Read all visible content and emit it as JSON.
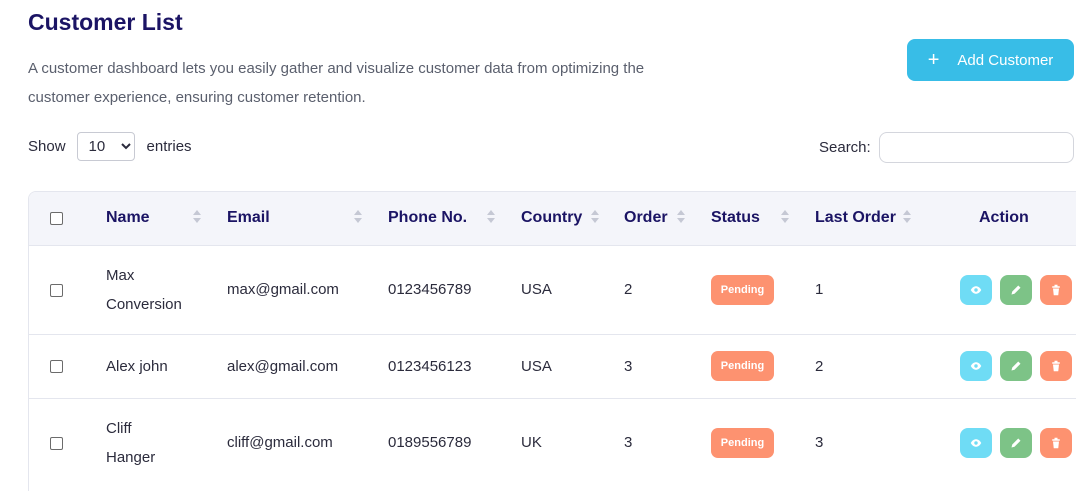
{
  "header": {
    "title": "Customer List",
    "description": "A customer dashboard lets you easily gather and visualize customer data from optimizing the customer experience, ensuring customer retention.",
    "add_button": {
      "icon": "plus-icon",
      "label": "Add Customer"
    }
  },
  "controls": {
    "show_label": "Show",
    "entries_value": "10",
    "entries_options": [
      "10"
    ],
    "entries_label": "entries",
    "search_label": "Search:",
    "search_value": ""
  },
  "table": {
    "columns": [
      "Name",
      "Email",
      "Phone No.",
      "Country",
      "Order",
      "Status",
      "Last Order",
      "Action"
    ],
    "rows": [
      {
        "name_line1": "Max",
        "name_line2": "Conversion",
        "email": "max@gmail.com",
        "phone": "0123456789",
        "country": "USA",
        "order": "2",
        "status": "Pending",
        "last_order": "1"
      },
      {
        "name_line1": "Alex john",
        "name_line2": "",
        "email": "alex@gmail.com",
        "phone": "0123456123",
        "country": "USA",
        "order": "3",
        "status": "Pending",
        "last_order": "2"
      },
      {
        "name_line1": "Cliff",
        "name_line2": "Hanger",
        "email": "cliff@gmail.com",
        "phone": "0189556789",
        "country": "UK",
        "order": "3",
        "status": "Pending",
        "last_order": "3"
      }
    ],
    "action_icons": [
      "eye-icon",
      "pencil-icon",
      "trash-icon"
    ]
  },
  "colors": {
    "title": "#1b1464",
    "add_button": "#38bde7",
    "pending_badge": "#fd9270",
    "view_button": "#6fdcf5",
    "edit_button": "#7dc387",
    "delete_button": "#fd9270",
    "header_bg": "#f4f5fa"
  }
}
